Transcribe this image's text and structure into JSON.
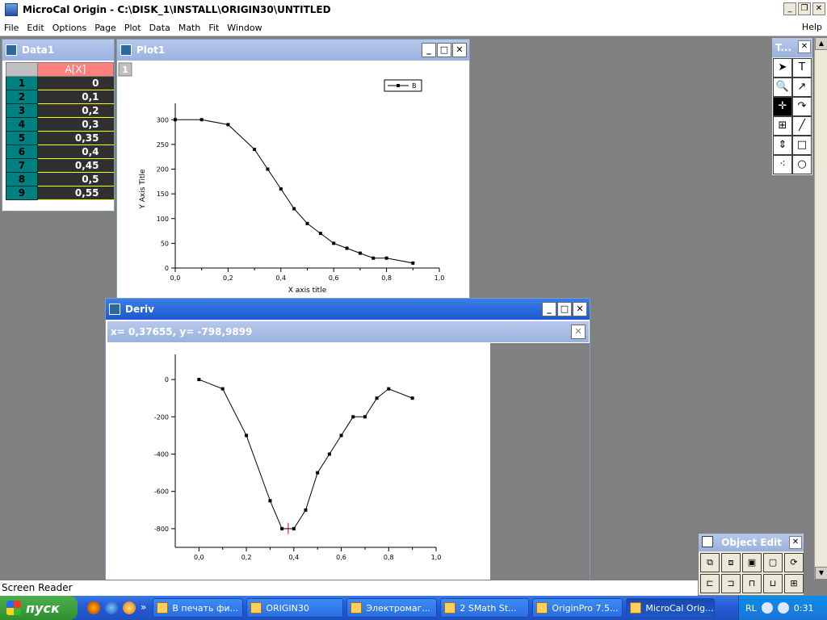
{
  "app": {
    "title": "MicroCal Origin - C:\\DISK_1\\INSTALL\\ORIGIN30\\UNTITLED",
    "window_buttons": {
      "minimize": "_",
      "restore": "❐",
      "close": "✕"
    }
  },
  "menu": [
    "File",
    "Edit",
    "Options",
    "Page",
    "Plot",
    "Data",
    "Math",
    "Fit",
    "Window"
  ],
  "menu_help": "Help",
  "data1": {
    "title": "Data1",
    "column_header": "A[X]",
    "rows": [
      {
        "n": "1",
        "v": "0"
      },
      {
        "n": "2",
        "v": "0,1"
      },
      {
        "n": "3",
        "v": "0,2"
      },
      {
        "n": "4",
        "v": "0,3"
      },
      {
        "n": "5",
        "v": "0,35"
      },
      {
        "n": "6",
        "v": "0,4"
      },
      {
        "n": "7",
        "v": "0,45"
      },
      {
        "n": "8",
        "v": "0,5"
      },
      {
        "n": "9",
        "v": "0,55"
      }
    ]
  },
  "plot1": {
    "title": "Plot1",
    "layer_label": "1",
    "legend": "B"
  },
  "deriv": {
    "title": "Deriv",
    "readout": "x= 0,37655, y= -798,9899"
  },
  "toolbox": {
    "title": "T...",
    "tools": [
      {
        "name": "pointer-tool-icon",
        "glyph": "➤"
      },
      {
        "name": "text-tool-icon",
        "glyph": "T"
      },
      {
        "name": "zoom-tool-icon",
        "glyph": "🔍"
      },
      {
        "name": "arrow-tool-icon",
        "glyph": "↗"
      },
      {
        "name": "crosshair-tool-icon",
        "glyph": "✛"
      },
      {
        "name": "curved-arrow-tool-icon",
        "glyph": "↷"
      },
      {
        "name": "data-selector-tool-icon",
        "glyph": "⊞"
      },
      {
        "name": "line-tool-icon",
        "glyph": "╱"
      },
      {
        "name": "scale-tool-icon",
        "glyph": "⇕"
      },
      {
        "name": "rectangle-tool-icon",
        "glyph": "□"
      },
      {
        "name": "scatter-tool-icon",
        "glyph": "⁖"
      },
      {
        "name": "circle-tool-icon",
        "glyph": "○"
      }
    ]
  },
  "object_edit": {
    "title": "Object Edit",
    "buttons": [
      "group-icon",
      "ungroup-icon",
      "front-icon",
      "back-icon",
      "rotate-icon",
      "align-left-icon",
      "align-right-icon",
      "align-top-icon",
      "align-bottom-icon",
      "align-center-icon"
    ]
  },
  "status": "Screen Reader",
  "taskbar": {
    "start": "пуск",
    "tasks": [
      {
        "label": "В печать фи...",
        "active": false
      },
      {
        "label": "ORIGIN30",
        "active": false
      },
      {
        "label": "Электромаг...",
        "active": false
      },
      {
        "label": "2 SMath St...",
        "active": false
      },
      {
        "label": "OriginPro 7.5...",
        "active": false
      },
      {
        "label": "MicroCal Orig...",
        "active": true
      }
    ],
    "lang": "RL",
    "clock": "0:31"
  },
  "chart_data": [
    {
      "type": "line",
      "title": "",
      "xlabel": "X axis title",
      "ylabel": "Y Axis Title",
      "xlim": [
        0,
        1.0
      ],
      "ylim": [
        0,
        320
      ],
      "xticks": [
        "0,0",
        "0,2",
        "0,4",
        "0,6",
        "0,8",
        "1,0"
      ],
      "yticks": [
        "0",
        "50",
        "100",
        "150",
        "200",
        "250",
        "300"
      ],
      "series": [
        {
          "name": "B",
          "x": [
            0,
            0.1,
            0.2,
            0.3,
            0.35,
            0.4,
            0.45,
            0.5,
            0.55,
            0.6,
            0.65,
            0.7,
            0.75,
            0.8,
            0.9
          ],
          "y": [
            300,
            300,
            290,
            240,
            200,
            160,
            120,
            90,
            70,
            50,
            40,
            30,
            20,
            20,
            10
          ]
        }
      ],
      "legend": "top-right",
      "grid": false
    },
    {
      "type": "line",
      "title": "",
      "xlabel": "",
      "ylabel": "",
      "xlim": [
        -0.1,
        1.0
      ],
      "ylim": [
        -900,
        100
      ],
      "xticks": [
        "0,0",
        "0,2",
        "0,4",
        "0,6",
        "0,8",
        "1,0"
      ],
      "yticks": [
        "0",
        "-200",
        "-400",
        "-600",
        "-800"
      ],
      "series": [
        {
          "x": [
            0,
            0.1,
            0.2,
            0.3,
            0.35,
            0.4,
            0.45,
            0.5,
            0.55,
            0.6,
            0.65,
            0.7,
            0.75,
            0.8,
            0.9
          ],
          "y": [
            0,
            -50,
            -300,
            -650,
            -800,
            -800,
            -700,
            -500,
            -400,
            -300,
            -200,
            -200,
            -100,
            -50,
            -100
          ]
        }
      ],
      "cursor": {
        "x": 0.37655,
        "y": -798.9899
      },
      "grid": false
    }
  ]
}
